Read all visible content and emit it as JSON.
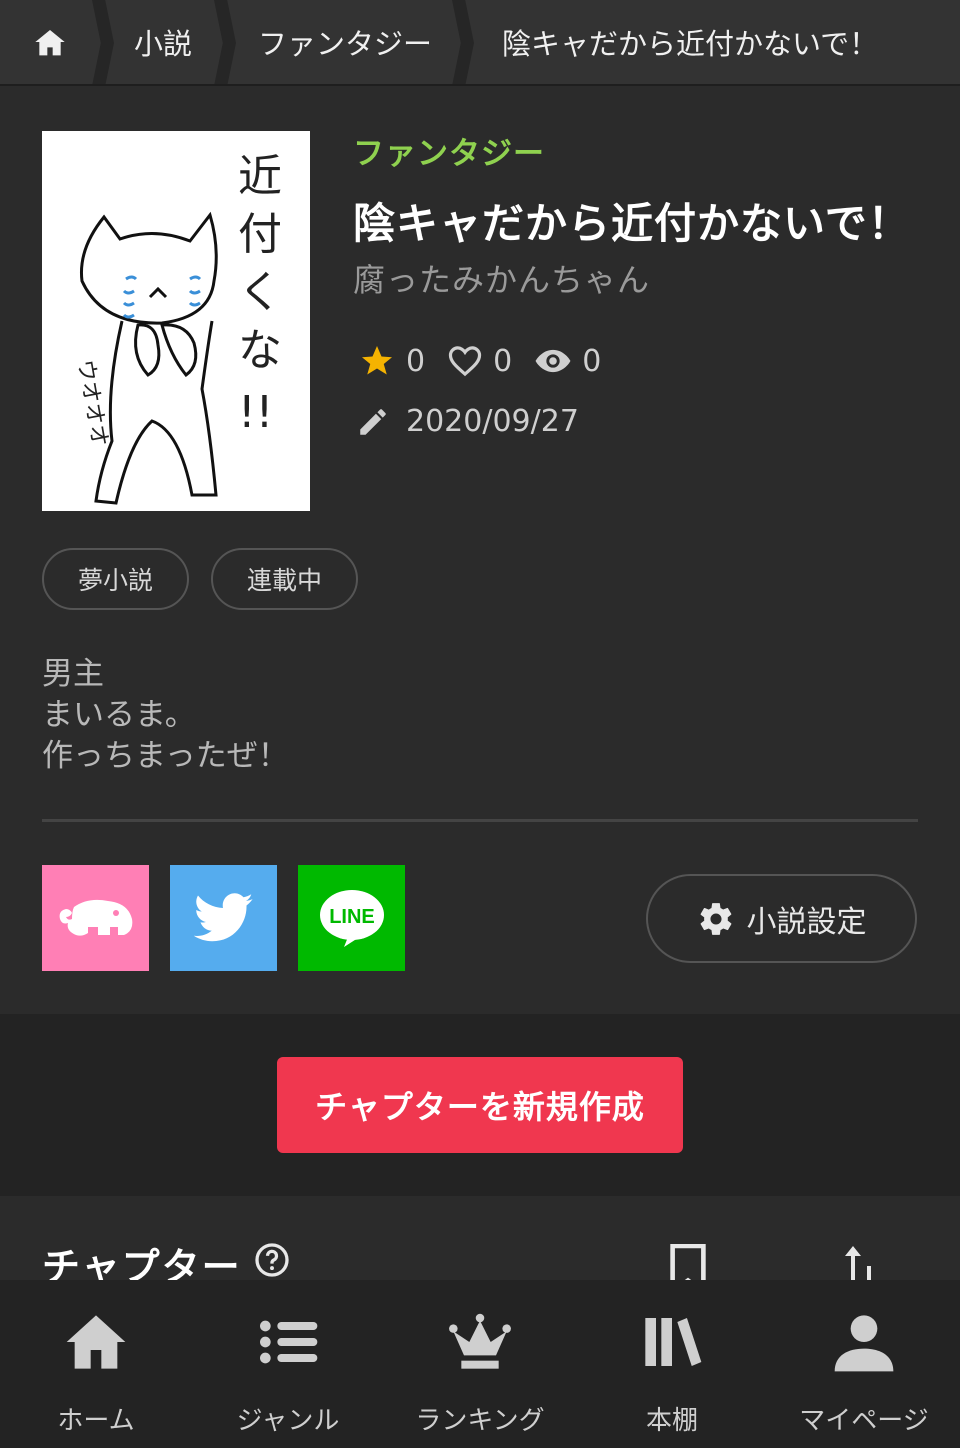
{
  "breadcrumb": {
    "items": [
      "小説",
      "ファンタジー",
      "陰キャだから近付かないで！"
    ]
  },
  "novel": {
    "genre": "ファンタジー",
    "title": "陰キャだから近付かないで！",
    "author": "腐ったみかんちゃん",
    "stars": "0",
    "likes": "0",
    "views": "0",
    "updated": "2020/09/27",
    "cover_text": "近付くな!!",
    "cover_side_text": "ウオオオ",
    "tags": [
      "夢小説",
      "連載中"
    ],
    "description": [
      "男主",
      "まいるま。",
      "作っちまったぜ！"
    ]
  },
  "share": {
    "line_label": "LINE"
  },
  "settings_label": "小説設定",
  "create_chapter_label": "チャプターを新規作成",
  "chapters": {
    "title": "チャプター"
  },
  "bottom_nav": [
    {
      "label": "ホーム",
      "icon": "home-icon"
    },
    {
      "label": "ジャンル",
      "icon": "list-icon"
    },
    {
      "label": "ランキング",
      "icon": "crown-icon"
    },
    {
      "label": "本棚",
      "icon": "bookshelf-icon"
    },
    {
      "label": "マイページ",
      "icon": "person-icon"
    }
  ],
  "colors": {
    "accent_green": "#8fd14f",
    "create_button": "#f0374f",
    "star": "#f5b301",
    "twitter": "#55acee",
    "line": "#00b900",
    "meiyo": "#ff7fb5"
  }
}
